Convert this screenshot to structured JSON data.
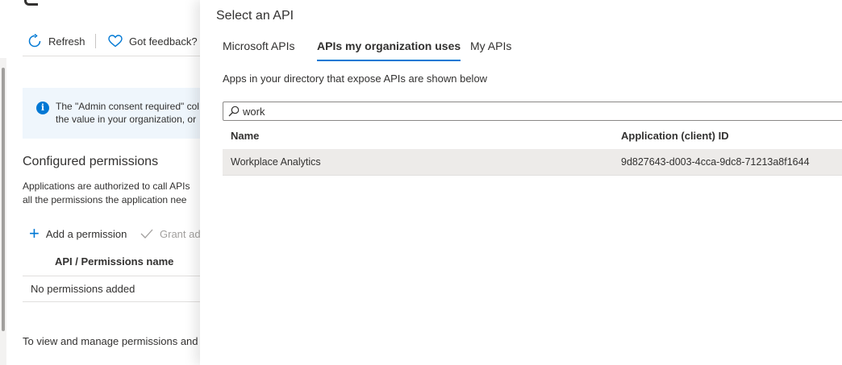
{
  "background": {
    "toolbar": {
      "refresh_label": "Refresh",
      "feedback_label": "Got feedback?"
    },
    "info_banner": {
      "line1": "The \"Admin consent required\" col",
      "line2": "the value in your organization, or"
    },
    "configured": {
      "title": "Configured permissions",
      "desc_line1": "Applications are authorized to call APIs",
      "desc_line2": "all the permissions the application nee"
    },
    "actions": {
      "add_permission": "Add a permission",
      "grant_admin": "Grant ad"
    },
    "permissions_table": {
      "column_header": "API / Permissions name",
      "empty_text": "No permissions added"
    },
    "footer_text": "To view and manage permissions and u"
  },
  "blade": {
    "title": "Select an API",
    "tabs": [
      {
        "label": "Microsoft APIs",
        "selected": false
      },
      {
        "label": "APIs my organization uses",
        "selected": true
      },
      {
        "label": "My APIs",
        "selected": false
      }
    ],
    "description": "Apps in your directory that expose APIs are shown below",
    "search": {
      "value": "work",
      "icon": "search-icon"
    },
    "table": {
      "columns": [
        "Name",
        "Application (client) ID"
      ],
      "rows": [
        {
          "name": "Workplace Analytics",
          "client_id": "9d827643-d003-4cca-9dc8-71213a8f1644"
        }
      ]
    }
  },
  "colors": {
    "accent": "#0078d4",
    "selected_row": "#edebe9",
    "info_banner": "#eff6fc"
  }
}
